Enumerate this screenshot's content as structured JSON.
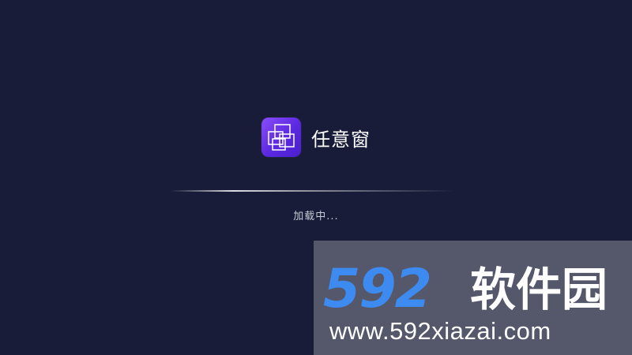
{
  "app": {
    "name": "任意窗",
    "icon": "overlapping-windows-icon",
    "icon_gradient": [
      "#8b4dfc",
      "#4a1fcf"
    ]
  },
  "loading": {
    "text": "加载中..."
  },
  "watermark": {
    "logo_digits": "592",
    "logo_text": "软件园",
    "url": "www.592xiazai.com",
    "digits_color": "#3d8af0"
  },
  "colors": {
    "background": "#181c38"
  }
}
